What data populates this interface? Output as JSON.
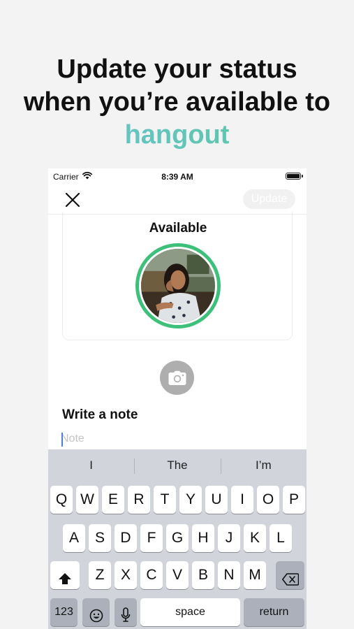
{
  "headline": {
    "line1": "Update your status",
    "line2": "when you’re available to",
    "accent": "hangout"
  },
  "status_bar": {
    "carrier": "Carrier",
    "time": "8:39 AM"
  },
  "navbar": {
    "update_label": "Update"
  },
  "card": {
    "title": "Available",
    "ring_color": "#3cc07a"
  },
  "note": {
    "title": "Write a note",
    "placeholder": "Note",
    "value": ""
  },
  "keyboard": {
    "suggestions": [
      "I",
      "The",
      "I’m"
    ],
    "row1": [
      "Q",
      "W",
      "E",
      "R",
      "T",
      "Y",
      "U",
      "I",
      "O",
      "P"
    ],
    "row2": [
      "A",
      "S",
      "D",
      "F",
      "G",
      "H",
      "J",
      "K",
      "L"
    ],
    "row3": [
      "Z",
      "X",
      "C",
      "V",
      "B",
      "N",
      "M"
    ],
    "numbers_label": "123",
    "space_label": "space",
    "return_label": "return"
  }
}
